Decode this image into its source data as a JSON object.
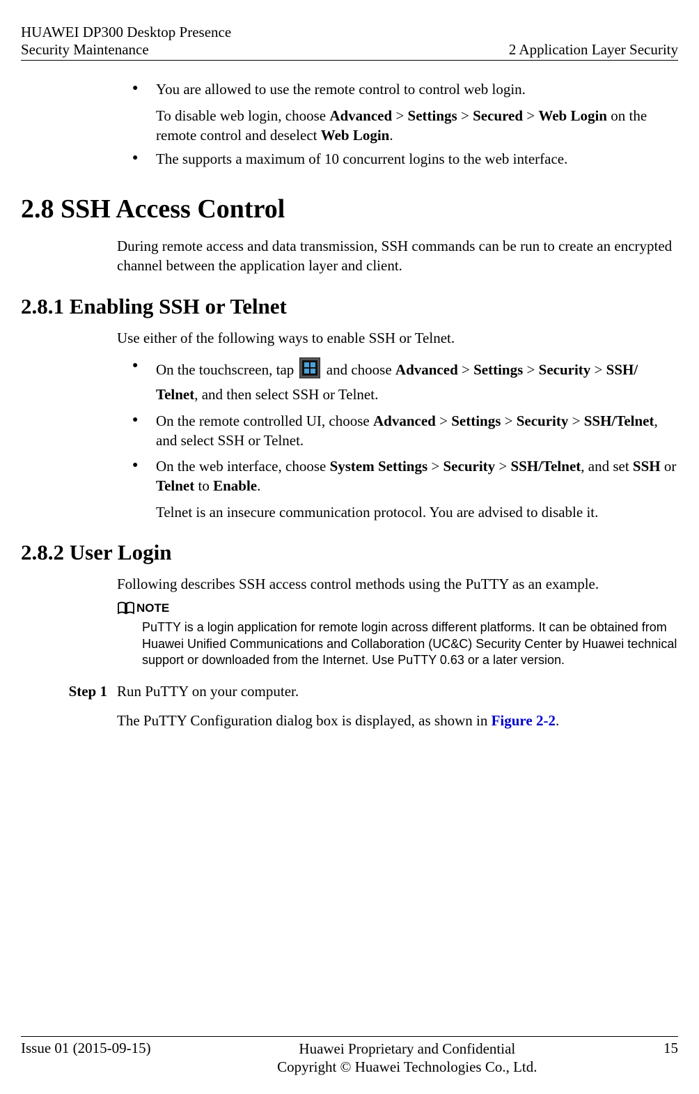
{
  "header": {
    "left_line1": "HUAWEI DP300 Desktop Presence",
    "left_line2": "Security Maintenance",
    "right": "2 Application Layer Security"
  },
  "bullets_top": {
    "item1_line1": "You are allowed to use the remote control to control web login.",
    "item1_line2_a": "To disable web login, choose ",
    "item1_adv": "Advanced",
    "item1_gt": " > ",
    "item1_settings": "Settings",
    "item1_secured": "Secured",
    "item1_weblogin": "Web Login",
    "item1_line2_b": " on the remote control and deselect ",
    "item1_weblogin2": "Web Login",
    "item1_period": ".",
    "item2": "The supports a maximum of 10 concurrent logins to the web interface."
  },
  "section28": {
    "heading": "2.8 SSH Access Control",
    "para": "During remote access and data transmission, SSH commands can be run to create an encrypted channel between the application layer and client."
  },
  "section281": {
    "heading": "2.8.1 Enabling SSH or Telnet",
    "intro": "Use either of the following ways to enable SSH or Telnet.",
    "b1_a": "On the touchscreen, tap ",
    "b1_b": " and choose ",
    "adv": "Advanced",
    "gt": " > ",
    "settings": "Settings",
    "security": "Security",
    "sshtelnet_split_a": "SSH/",
    "sshtelnet_split_b": "Telnet",
    "b1_c": ", and then select SSH or Telnet.",
    "b2_a": "On the remote controlled UI, choose ",
    "sshtelnet": "SSH/Telnet",
    "b2_b": ", and select SSH or Telnet.",
    "b3_a": "On the web interface, choose ",
    "sys_settings": "System Settings",
    "b3_b": ", and set ",
    "ssh": "SSH",
    "or": " or ",
    "telnet": "Telnet",
    "to": " to ",
    "enable": "Enable",
    "b3_c": ".",
    "b3_line2": "Telnet is an insecure communication protocol. You are advised to disable it."
  },
  "section282": {
    "heading": "2.8.2 User Login",
    "para": "Following describes SSH access control methods using the PuTTY as an example.",
    "note_label": "NOTE",
    "note_text": "PuTTY is a login application for remote login across different platforms. It can be obtained from Huawei Unified Communications and Collaboration (UC&C) Security Center by Huawei technical support or downloaded from the Internet. Use PuTTY 0.63 or a later version.",
    "step1_label": "Step 1",
    "step1_line1": "Run PuTTY on your computer.",
    "step1_line2_a": "The PuTTY Configuration dialog box is displayed, as shown in ",
    "figref": "Figure 2-2",
    "step1_line2_b": "."
  },
  "footer": {
    "left": "Issue 01 (2015-09-15)",
    "center_line1": "Huawei Proprietary and Confidential",
    "center_line2": "Copyright © Huawei Technologies Co., Ltd.",
    "right": "15"
  }
}
